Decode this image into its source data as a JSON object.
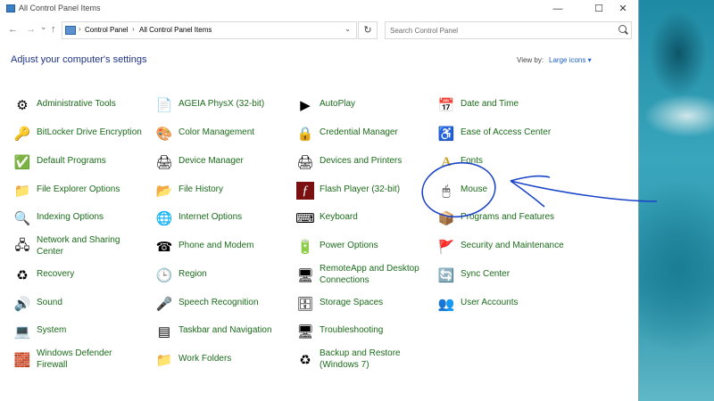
{
  "window": {
    "title": "All Control Panel Items"
  },
  "titlebar_buttons": {
    "minimize": "—",
    "maximize": "☐",
    "close": "✕"
  },
  "nav": {
    "back": "←",
    "forward": "→",
    "recent": "⌄",
    "up": "↑",
    "refresh": "↻"
  },
  "address": {
    "breadcrumbs": [
      "Control Panel",
      "All Control Panel Items"
    ],
    "separator": "›",
    "dropdown": "⌄"
  },
  "search": {
    "placeholder": "Search Control Panel"
  },
  "main": {
    "heading": "Adjust your computer's settings",
    "view_by_label": "View by:",
    "view_by_value": "Large icons ▾"
  },
  "items": [
    {
      "label": "Administrative Tools",
      "icon": "administrative-tools-icon",
      "glyph": "⚙"
    },
    {
      "label": "BitLocker Drive Encryption",
      "icon": "bitlocker-icon",
      "glyph": "🔑"
    },
    {
      "label": "Default Programs",
      "icon": "default-programs-icon",
      "glyph": "✅"
    },
    {
      "label": "File Explorer Options",
      "icon": "file-explorer-options-icon",
      "glyph": "📁"
    },
    {
      "label": "Indexing Options",
      "icon": "indexing-options-icon",
      "glyph": "🔍"
    },
    {
      "label": "Network and Sharing Center",
      "icon": "network-sharing-icon",
      "glyph": "🖧"
    },
    {
      "label": "Recovery",
      "icon": "recovery-icon",
      "glyph": "♻"
    },
    {
      "label": "Sound",
      "icon": "sound-icon",
      "glyph": "🔊"
    },
    {
      "label": "System",
      "icon": "system-icon",
      "glyph": "💻"
    },
    {
      "label": "Windows Defender Firewall",
      "icon": "firewall-icon",
      "glyph": "🧱"
    },
    {
      "label": "AGEIA PhysX (32-bit)",
      "icon": "physx-icon",
      "glyph": "📄"
    },
    {
      "label": "Color Management",
      "icon": "color-management-icon",
      "glyph": "🎨"
    },
    {
      "label": "Device Manager",
      "icon": "device-manager-icon",
      "glyph": "🖨"
    },
    {
      "label": "File History",
      "icon": "file-history-icon",
      "glyph": "📂"
    },
    {
      "label": "Internet Options",
      "icon": "internet-options-icon",
      "glyph": "🌐"
    },
    {
      "label": "Phone and Modem",
      "icon": "phone-modem-icon",
      "glyph": "☎"
    },
    {
      "label": "Region",
      "icon": "region-icon",
      "glyph": "🕒"
    },
    {
      "label": "Speech Recognition",
      "icon": "speech-recognition-icon",
      "glyph": "🎤"
    },
    {
      "label": "Taskbar and Navigation",
      "icon": "taskbar-navigation-icon",
      "glyph": "▤"
    },
    {
      "label": "Work Folders",
      "icon": "work-folders-icon",
      "glyph": "📁"
    },
    {
      "label": "AutoPlay",
      "icon": "autoplay-icon",
      "glyph": "▶"
    },
    {
      "label": "Credential Manager",
      "icon": "credential-manager-icon",
      "glyph": "🔒"
    },
    {
      "label": "Devices and Printers",
      "icon": "devices-printers-icon",
      "glyph": "🖨"
    },
    {
      "label": "Flash Player (32-bit)",
      "icon": "flash-player-icon",
      "glyph": "ƒ"
    },
    {
      "label": "Keyboard",
      "icon": "keyboard-icon",
      "glyph": "⌨"
    },
    {
      "label": "Power Options",
      "icon": "power-options-icon",
      "glyph": "🔋"
    },
    {
      "label": "RemoteApp and Desktop Connections",
      "icon": "remoteapp-icon",
      "glyph": "🖥"
    },
    {
      "label": "Storage Spaces",
      "icon": "storage-spaces-icon",
      "glyph": "🗄"
    },
    {
      "label": "Troubleshooting",
      "icon": "troubleshooting-icon",
      "glyph": "🖥"
    },
    {
      "label": "Backup and Restore (Windows 7)",
      "icon": "backup-restore-icon",
      "glyph": "♻"
    },
    {
      "label": "Date and Time",
      "icon": "date-time-icon",
      "glyph": "📅"
    },
    {
      "label": "Ease of Access Center",
      "icon": "ease-of-access-icon",
      "glyph": "♿"
    },
    {
      "label": "Fonts",
      "icon": "fonts-icon",
      "glyph": "A"
    },
    {
      "label": "Mouse",
      "icon": "mouse-icon",
      "glyph": "🖱"
    },
    {
      "label": "Programs and Features",
      "icon": "programs-features-icon",
      "glyph": "📦"
    },
    {
      "label": "Security and Maintenance",
      "icon": "security-maintenance-icon",
      "glyph": "🚩"
    },
    {
      "label": "Sync Center",
      "icon": "sync-center-icon",
      "glyph": "🔄"
    },
    {
      "label": "User Accounts",
      "icon": "user-accounts-icon",
      "glyph": "👥"
    }
  ],
  "colors": {
    "link": "#1a6b1a",
    "heading": "#1e3287",
    "annotation": "#1a44c8"
  }
}
